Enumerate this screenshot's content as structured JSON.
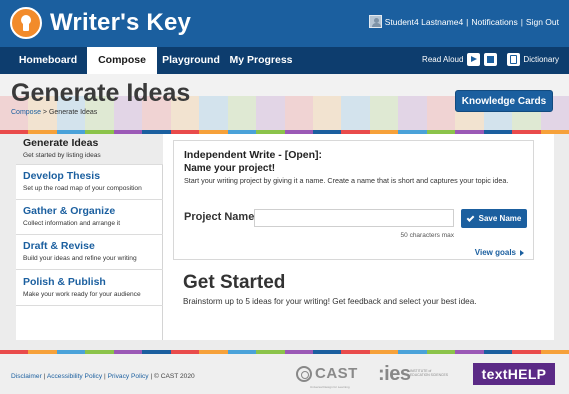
{
  "header": {
    "app_title": "Writer's Key",
    "user_name": "Student4 Lastname4",
    "separator": "|",
    "notifications": "Notifications",
    "sign_out": "Sign Out"
  },
  "nav": {
    "tabs": [
      {
        "label": "Homeboard",
        "active": false
      },
      {
        "label": "Compose",
        "active": true
      },
      {
        "label": "Playground",
        "active": false
      },
      {
        "label": "My Progress",
        "active": false
      }
    ],
    "read_aloud": "Read Aloud",
    "dictionary": "Dictionary"
  },
  "page": {
    "title": "Generate Ideas",
    "breadcrumb": {
      "link": "Compose",
      "separator": ">",
      "current": "Generate Ideas"
    },
    "knowledge_cards": "Knowledge Cards"
  },
  "sidebar": {
    "items": [
      {
        "title": "Generate Ideas",
        "desc": "Get started by listing ideas",
        "active": true
      },
      {
        "title": "Develop Thesis",
        "desc": "Set up the road map of your composition",
        "active": false
      },
      {
        "title": "Gather & Organize",
        "desc": "Collect information and arrange it",
        "active": false
      },
      {
        "title": "Draft & Revise",
        "desc": "Build your ideas and refine your writing",
        "active": false
      },
      {
        "title": "Polish & Publish",
        "desc": "Make your work ready for your audience",
        "active": false
      }
    ]
  },
  "main": {
    "card": {
      "heading": "Independent Write - [Open]:",
      "subheading": "Name your project!",
      "instructions": "Start your writing project by giving it a name. Create a name that is short and captures your topic idea.",
      "project_label": "Project Name:",
      "project_value": "",
      "save_label": "Save Name",
      "char_max": "50 characters max",
      "view_goals": "View goals"
    },
    "get_started": {
      "heading": "Get Started",
      "desc": "Brainstorm up to 5 ideas for your writing! Get feedback and select your best idea."
    }
  },
  "footer": {
    "disclaimer": "Disclaimer",
    "accessibility": "Accessibility Policy",
    "privacy": "Privacy Policy",
    "copyright": "© CAST 2020",
    "cast": "CAST",
    "cast_tag": "Universal Design for Learning",
    "ies": ":ies",
    "ies_line1": "INSTITUTE of",
    "ies_line2": "EDUCATION SCIENCES",
    "texthelp": "textHELP"
  },
  "colors": {
    "brand_blue": "#1b5f9f",
    "nav_dark": "#0d3d6e",
    "logo_orange": "#f28b2b",
    "texthelp_purple": "#5b2a86"
  }
}
